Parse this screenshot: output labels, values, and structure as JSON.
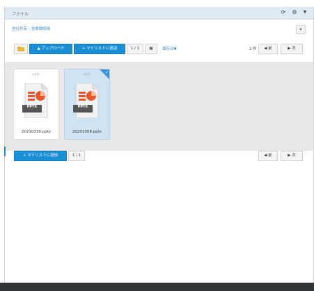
{
  "panel": {
    "title": "ファイル",
    "breadcrumb": "全社共有 › 全体周知用"
  },
  "toolbar": {
    "upload_label": "▲ アップロード",
    "add_mylist_label": "+ マイリストに追加",
    "page_indicator": "1 / 1",
    "sort_label": "保存日▼",
    "item_count": "2 件",
    "prev_label": "前",
    "next_label": "次"
  },
  "files": [
    {
      "extension": "pptx",
      "icon_label": "PPTX",
      "name": "20210330.pptx",
      "selected": false
    },
    {
      "extension": "pptx",
      "icon_label": "PPTX",
      "name": "20201008.pptx",
      "selected": true
    }
  ],
  "footer": {
    "add_mylist_label": "+ マイリストに追加",
    "page_indicator": "1 / 1",
    "prev_label": "前",
    "next_label": "次"
  },
  "colors": {
    "accent": "#1a8fd6",
    "titlebar": "#dfeaf3",
    "selected_card": "#cfe3f3",
    "ppt_orange": "#e8562a"
  }
}
